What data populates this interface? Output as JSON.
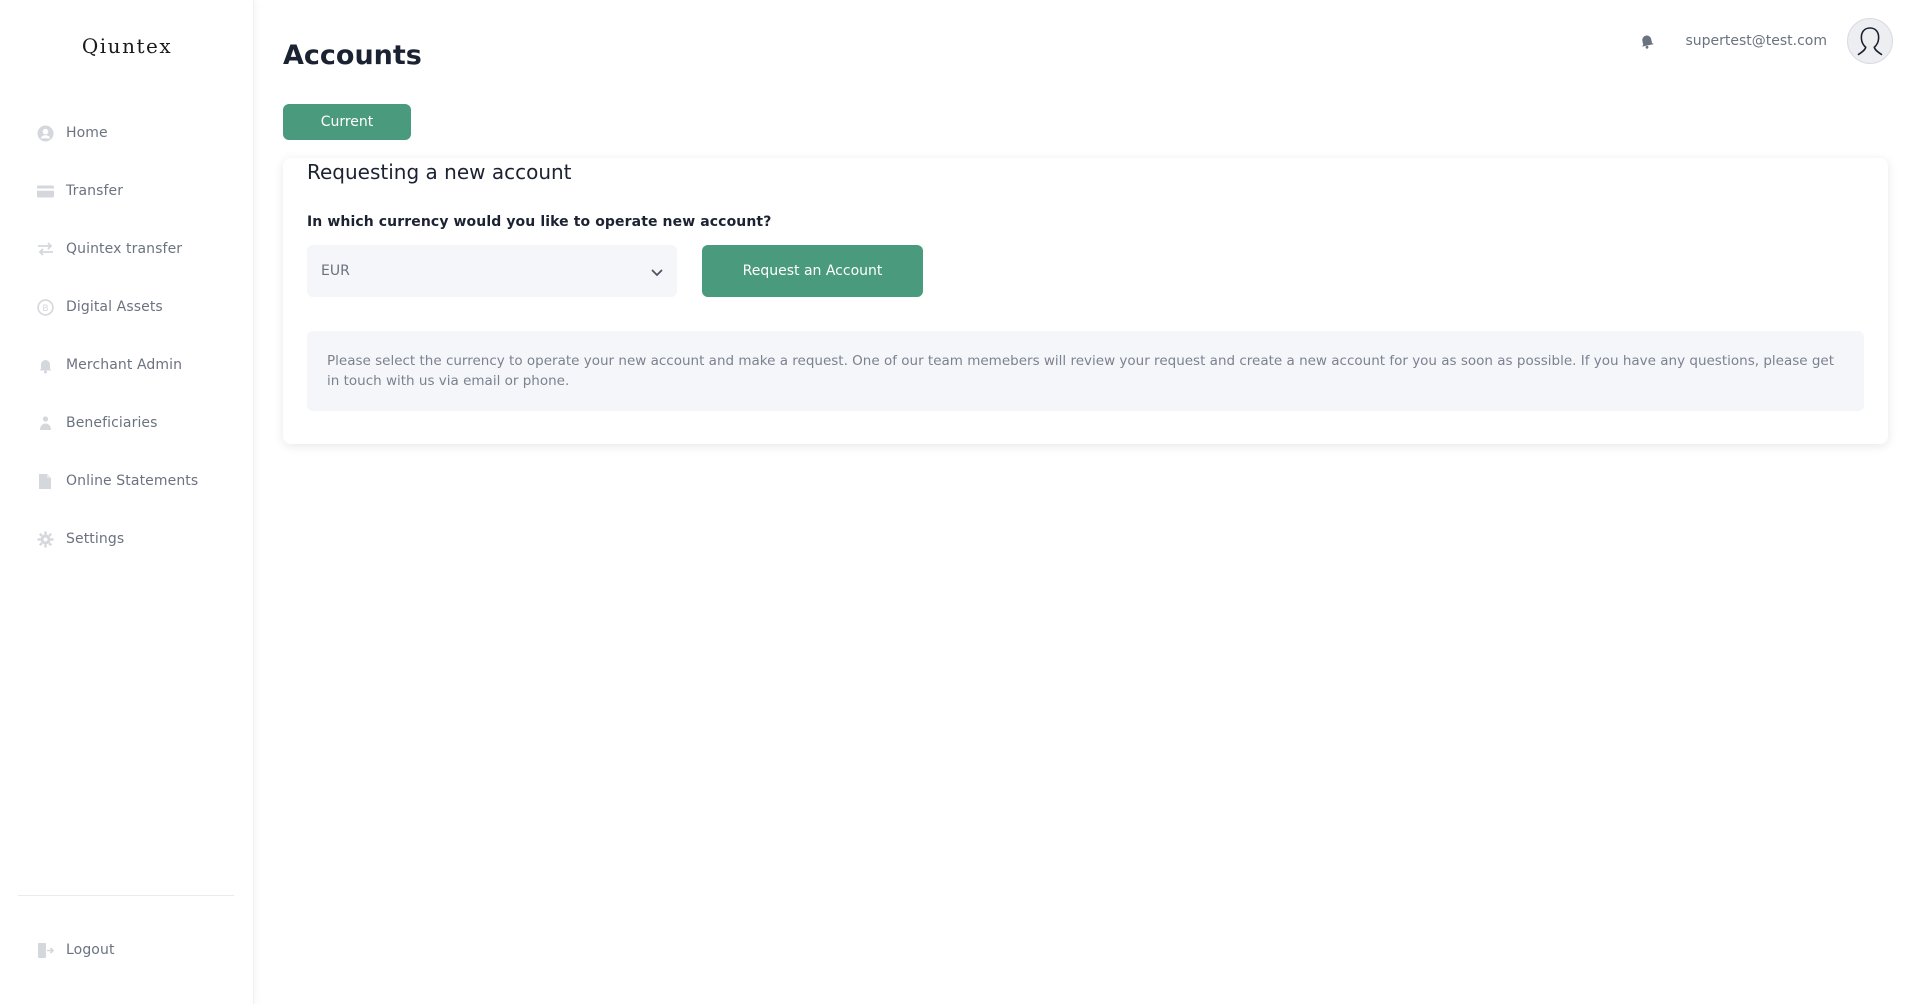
{
  "app": {
    "logo_text": "Qiuntex"
  },
  "sidebar": {
    "items": [
      {
        "label": "Home",
        "icon": "user-circle-icon"
      },
      {
        "label": "Transfer",
        "icon": "card-icon"
      },
      {
        "label": "Quintex transfer",
        "icon": "swap-arrows-icon"
      },
      {
        "label": "Digital Assets",
        "icon": "coin-icon"
      },
      {
        "label": "Merchant Admin",
        "icon": "bell-icon"
      },
      {
        "label": "Beneficiaries",
        "icon": "people-icon"
      },
      {
        "label": "Online Statements",
        "icon": "document-icon"
      },
      {
        "label": "Settings",
        "icon": "gear-icon"
      }
    ],
    "logout_label": "Logout"
  },
  "header": {
    "title": "Accounts",
    "user_email": "supertest@test.com"
  },
  "tabs": {
    "current_label": "Current"
  },
  "card": {
    "title": "Requesting a new account",
    "question": "In which currency would you like to operate new account?",
    "currency_select": {
      "value": "EUR"
    },
    "request_button_label": "Request an Account",
    "info_text": "Please select the currency to operate your new account and make a request. One of our team memebers will review your request and create a new account for you as soon as possible. If you have any questions, please get in touch with us via email or phone."
  },
  "colors": {
    "accent": "#4a9a7e",
    "muted_text": "#6b7280",
    "dark_text": "#1b2232",
    "panel_bg": "#f5f6f9"
  }
}
